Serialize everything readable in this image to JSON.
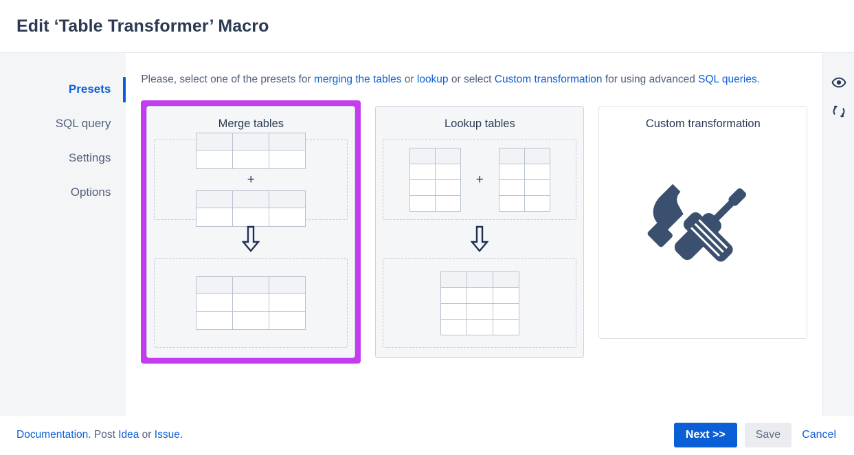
{
  "window": {
    "title": "Edit ‘Table Transformer’ Macro"
  },
  "sidebar": {
    "items": [
      {
        "label": "Presets",
        "active": true
      },
      {
        "label": "SQL query",
        "active": false
      },
      {
        "label": "Settings",
        "active": false
      },
      {
        "label": "Options",
        "active": false
      }
    ]
  },
  "intro": {
    "part1": "Please, select one of the presets for ",
    "link_merging": "merging the tables",
    "part2": " or ",
    "link_lookup": "lookup",
    "part3": " or select ",
    "link_custom": "Custom transformation",
    "part4": " for using advanced ",
    "link_sql": "SQL queries."
  },
  "right_rail": {
    "preview_label": "preview-eye",
    "refresh_label": "refresh-sync"
  },
  "presets": [
    {
      "id": "merge-tables",
      "title": "Merge tables",
      "selected": true,
      "inputs": [
        {
          "cols": 3,
          "rows": 2
        },
        {
          "cols": 3,
          "rows": 2
        }
      ],
      "operator": "+",
      "arrow": "⇩",
      "output": {
        "cols": 3,
        "rows": 3
      }
    },
    {
      "id": "lookup-tables",
      "title": "Lookup tables",
      "selected": false,
      "inputs": [
        {
          "cols": 2,
          "rows": 4
        },
        {
          "cols": 2,
          "rows": 4
        }
      ],
      "operator": "+",
      "arrow": "⇩",
      "output": {
        "cols": 3,
        "rows": 4
      }
    },
    {
      "id": "custom-transformation",
      "title": "Custom transformation",
      "selected": false,
      "icon": "hammer-screwdriver-icon"
    }
  ],
  "footer": {
    "documentation": "Documentation",
    "after_documentation": ". Post ",
    "idea": "Idea",
    "between": " or ",
    "issue": "Issue",
    "end": ".",
    "next_label": "Next >>",
    "save_label": "Save",
    "cancel_label": "Cancel"
  },
  "colors": {
    "accent_blue": "#0b5fd6",
    "selection_magenta": "#c33cf0",
    "title_navy": "#2b3a52",
    "icon_navy": "#253858"
  }
}
